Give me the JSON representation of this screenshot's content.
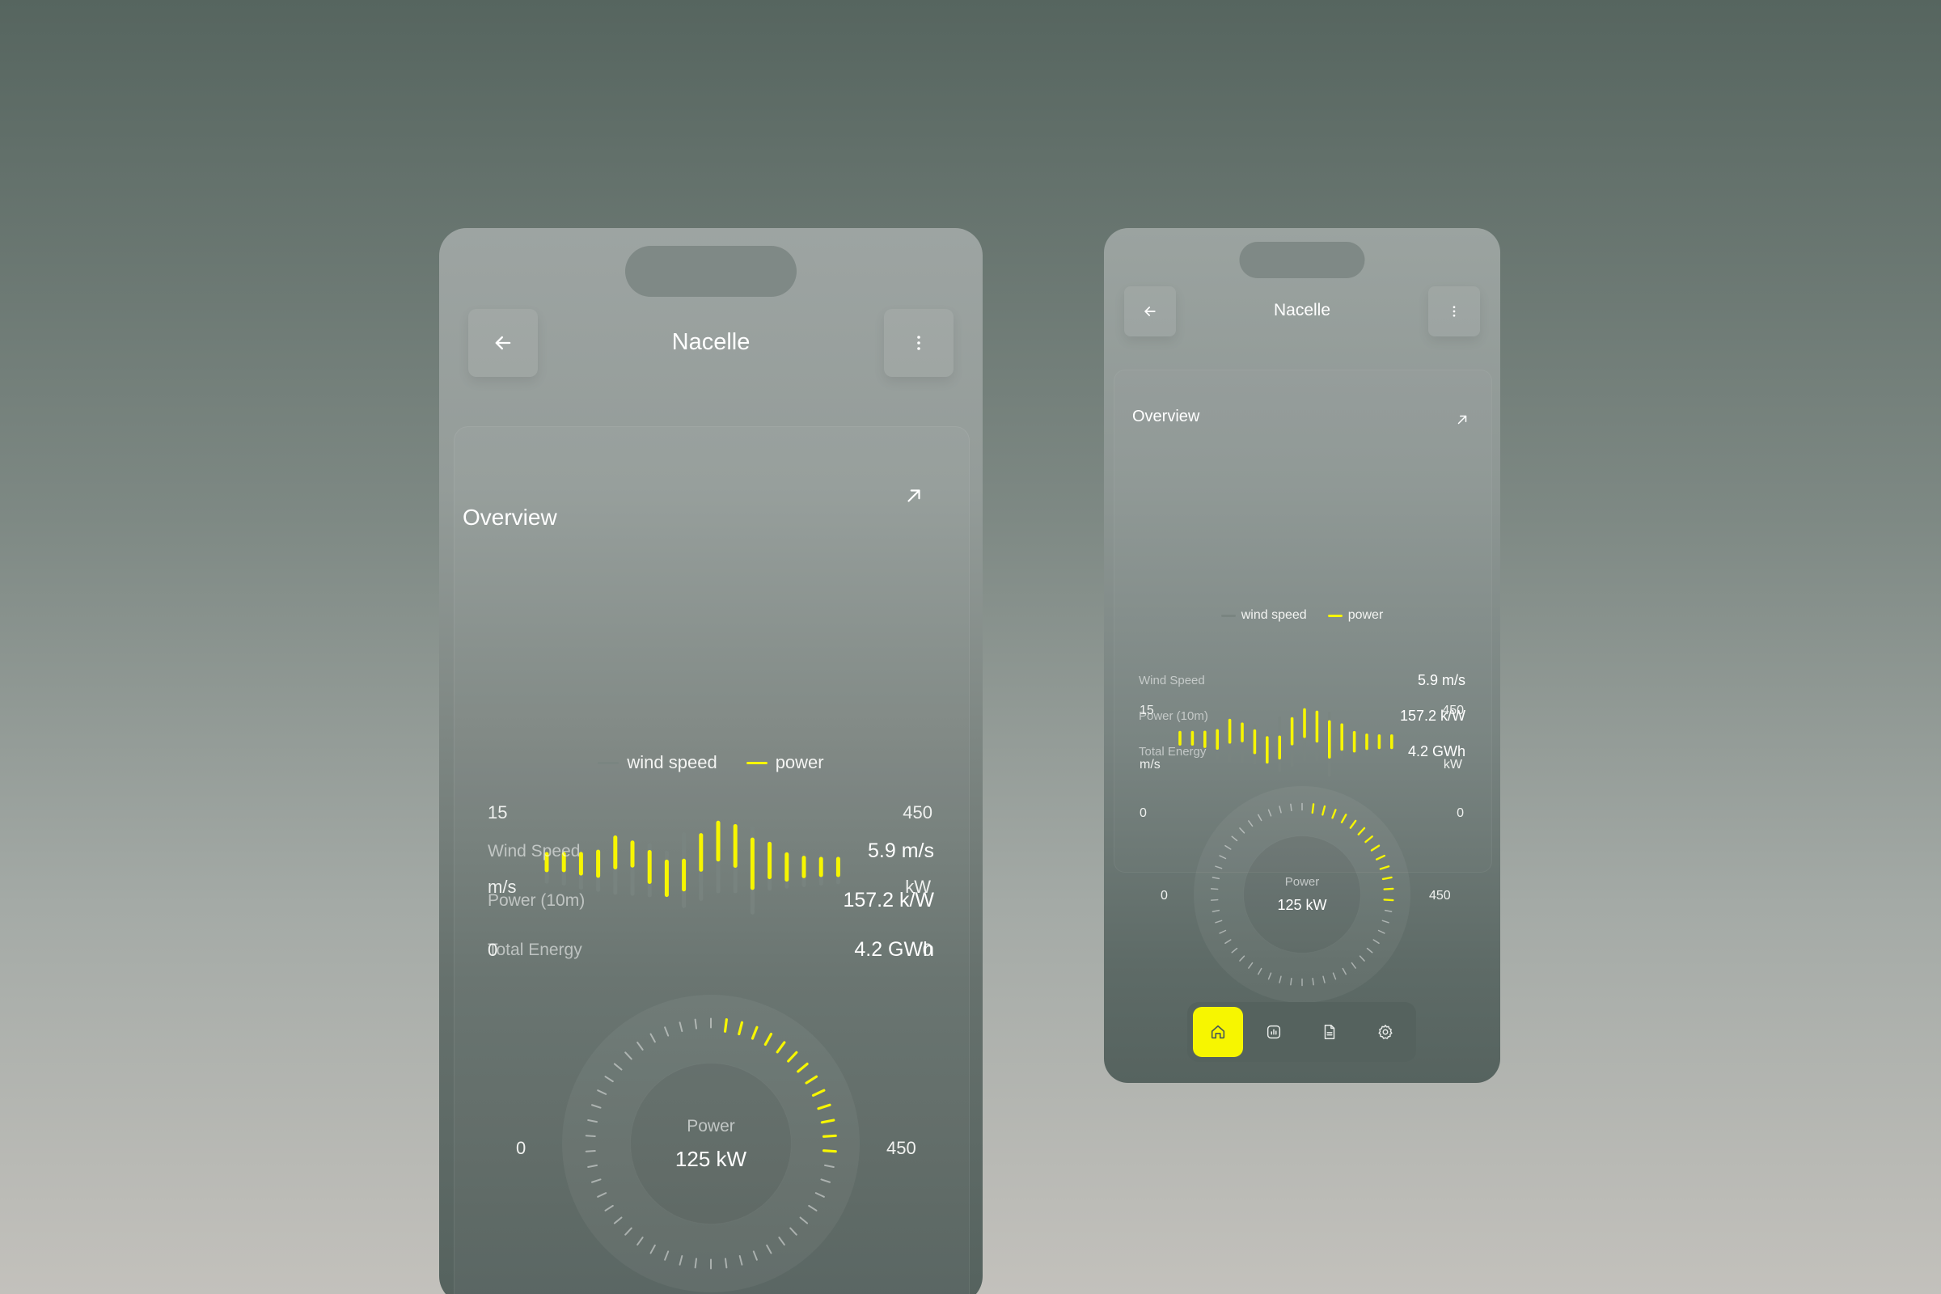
{
  "colors": {
    "accent": "#f7f600",
    "wind_bar": "#7a8581",
    "text": "#ffffff",
    "muted_text": "#c5cbc8"
  },
  "header": {
    "title": "Nacelle",
    "back_icon": "arrow-left-icon",
    "menu_icon": "more-vertical-icon"
  },
  "overview": {
    "title": "Overview",
    "expand_icon": "arrow-up-right-icon"
  },
  "chart_data": {
    "type": "bar",
    "left_axis": {
      "unit": "m/s",
      "top": "15",
      "bottom": "0",
      "ylim": [
        0,
        15
      ]
    },
    "right_axis": {
      "unit": "kW",
      "top": "450",
      "bottom": "0",
      "ylim": [
        0,
        450
      ]
    },
    "legend": [
      {
        "name": "wind speed",
        "color": "#7a8581"
      },
      {
        "name": "power",
        "color": "#f7f600"
      }
    ],
    "series": [
      {
        "name": "wind speed",
        "values": [
          4.5,
          5.2,
          6.8,
          7.6,
          8.8,
          9.2,
          9.8,
          6.8,
          14.0,
          11.2,
          8.2,
          8.2,
          16.5,
          7.2,
          6.4,
          5.8,
          5.2,
          4.7
        ]
      },
      {
        "name": "power",
        "values": [
          140,
          140,
          170,
          210,
          260,
          200,
          260,
          290,
          250,
          300,
          320,
          345,
          420,
          290,
          220,
          160,
          140,
          140
        ]
      }
    ]
  },
  "stats": [
    {
      "label": "Wind Speed",
      "value": "5.9 m/s"
    },
    {
      "label": "Power (10m)",
      "value": "157.2 k/W"
    },
    {
      "label": "Total Energy",
      "value": "4.2 GWh"
    }
  ],
  "gauge": {
    "label": "Power",
    "value_text": "125 kW",
    "min": "0",
    "max": "450",
    "current": 125,
    "range_max": 450
  },
  "tabbar": {
    "items": [
      {
        "icon": "home-icon",
        "active": true
      },
      {
        "icon": "bar-chart-icon",
        "active": false
      },
      {
        "icon": "document-icon",
        "active": false
      },
      {
        "icon": "settings-icon",
        "active": false
      }
    ]
  }
}
